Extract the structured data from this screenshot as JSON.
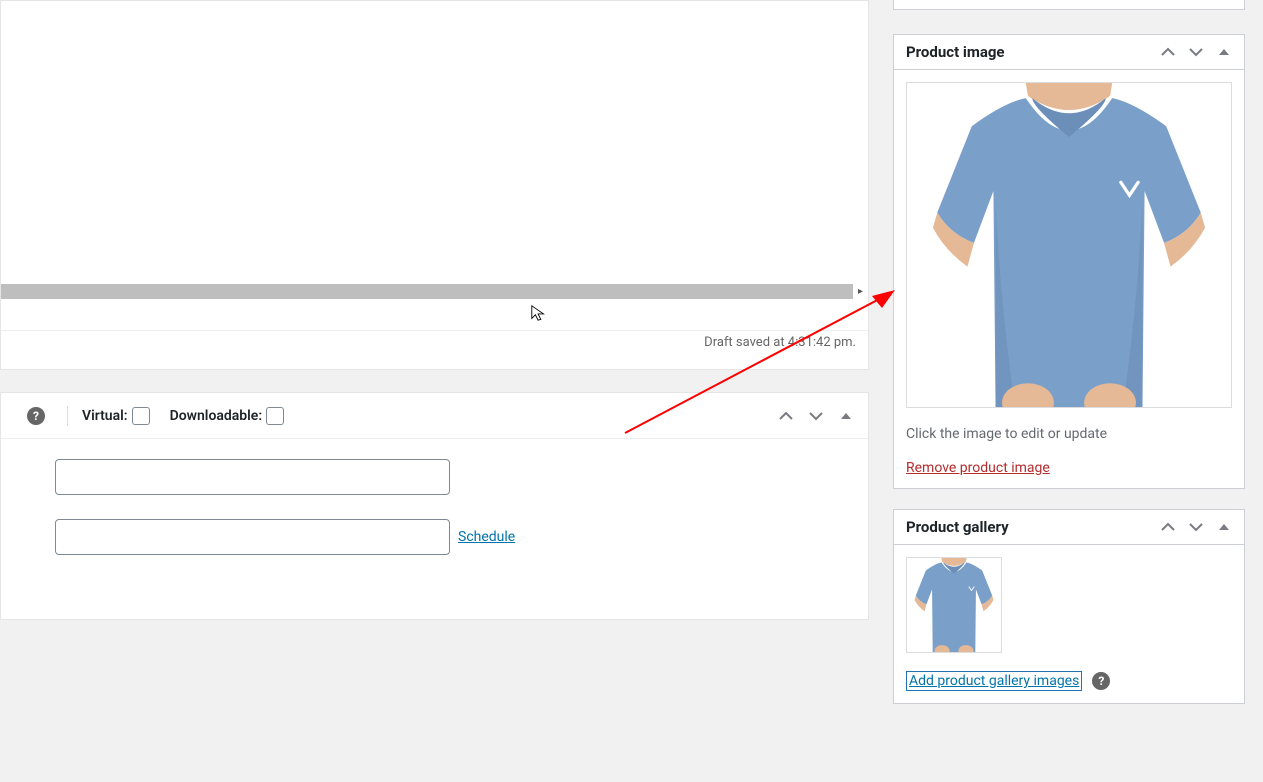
{
  "editor": {
    "draft_saved_text": "Draft saved at 4:31:42 pm."
  },
  "product_data": {
    "virtual_label": "Virtual:",
    "downloadable_label": "Downloadable:",
    "schedule_label": "Schedule"
  },
  "sidebar": {
    "product_image": {
      "title": "Product image",
      "hint": "Click the image to edit or update",
      "remove_label": "Remove product image"
    },
    "product_gallery": {
      "title": "Product gallery",
      "add_label": "Add product gallery images"
    }
  },
  "icons": {
    "help": "?",
    "chevron_up": "up",
    "chevron_down": "down",
    "collapse_triangle": "collapse"
  }
}
